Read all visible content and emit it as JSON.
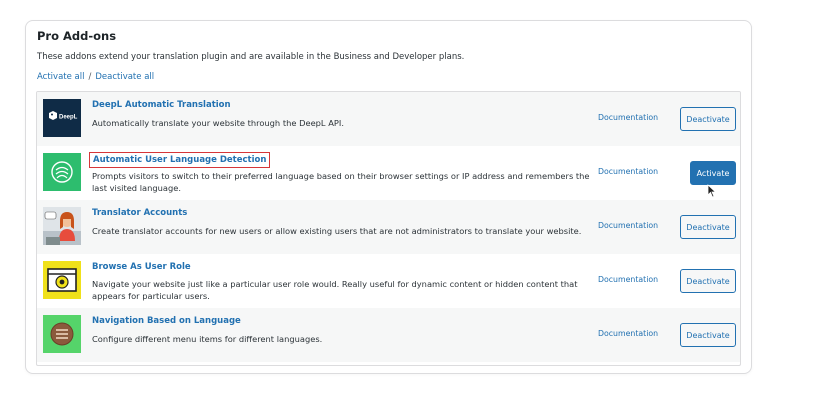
{
  "section": {
    "title": "Pro Add-ons",
    "description": "These addons extend your translation plugin and are available in the Business and Developer plans.",
    "activate_all": "Activate all",
    "separator": "/",
    "deactivate_all": "Deactivate all"
  },
  "addons": [
    {
      "name": "DeepL Automatic Translation",
      "description": "Automatically translate your website through the DeepL API.",
      "documentation": "Documentation",
      "button": "Deactivate",
      "icon": "deepl-logo-icon",
      "icon_text": "DeepL"
    },
    {
      "name": "Automatic User Language Detection",
      "description": "Prompts visitors to switch to their preferred language based on their browser settings or IP address and remembers the last visited language.",
      "documentation": "Documentation",
      "button": "Activate",
      "icon": "language-detection-icon"
    },
    {
      "name": "Translator Accounts",
      "description": "Create translator accounts for new users or allow existing users that are not administrators to translate your website.",
      "documentation": "Documentation",
      "button": "Deactivate",
      "icon": "translator-avatar-icon"
    },
    {
      "name": "Browse As User Role",
      "description": "Navigate your website just like a particular user role would. Really useful for dynamic content or hidden content that appears for particular users.",
      "documentation": "Documentation",
      "button": "Deactivate",
      "icon": "browse-window-eye-icon"
    },
    {
      "name": "Navigation Based on Language",
      "description": "Configure different menu items for different languages.",
      "documentation": "Documentation",
      "button": "Deactivate",
      "icon": "navigation-menu-icon"
    }
  ],
  "colors": {
    "link": "#2271b1",
    "primary_button": "#2271b1",
    "highlight_border": "#d63638"
  }
}
